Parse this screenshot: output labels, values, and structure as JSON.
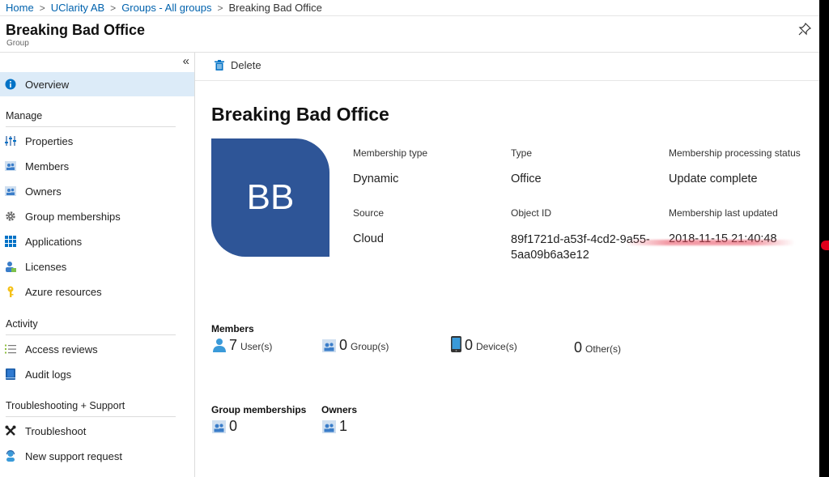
{
  "breadcrumb": {
    "items": [
      "Home",
      "UClarity AB",
      "Groups - All groups"
    ],
    "current": "Breaking Bad Office"
  },
  "header": {
    "title": "Breaking Bad Office",
    "subtitle": "Group"
  },
  "sidebar": {
    "overview": "Overview",
    "sections": {
      "manage": "Manage",
      "activity": "Activity",
      "support": "Troubleshooting + Support"
    },
    "items": {
      "properties": "Properties",
      "members": "Members",
      "owners": "Owners",
      "group_memberships": "Group memberships",
      "applications": "Applications",
      "licenses": "Licenses",
      "azure_resources": "Azure resources",
      "access_reviews": "Access reviews",
      "audit_logs": "Audit logs",
      "troubleshoot": "Troubleshoot",
      "new_support_request": "New support request"
    }
  },
  "toolbar": {
    "delete_label": "Delete"
  },
  "overview": {
    "title": "Breaking Bad Office",
    "avatar_initials": "BB",
    "avatar_color": "#2e5597",
    "properties": {
      "membership_type_label": "Membership type",
      "membership_type_value": "Dynamic",
      "type_label": "Type",
      "type_value": "Office",
      "processing_status_label": "Membership processing status",
      "processing_status_value": "Update complete",
      "source_label": "Source",
      "source_value": "Cloud",
      "object_id_label": "Object ID",
      "object_id_value": "89f1721d-a53f-4cd2-9a55-5aa09b6a3e12",
      "last_updated_label": "Membership last updated",
      "last_updated_value": "2018-11-15 21:40:48"
    },
    "members": {
      "title": "Members",
      "users_count": "7",
      "users_unit": "User(s)",
      "groups_count": "0",
      "groups_unit": "Group(s)",
      "devices_count": "0",
      "devices_unit": "Device(s)",
      "others_count": "0",
      "others_unit": "Other(s)"
    },
    "group_memberships": {
      "title": "Group memberships",
      "count": "0"
    },
    "owners": {
      "title": "Owners",
      "count": "1"
    }
  }
}
